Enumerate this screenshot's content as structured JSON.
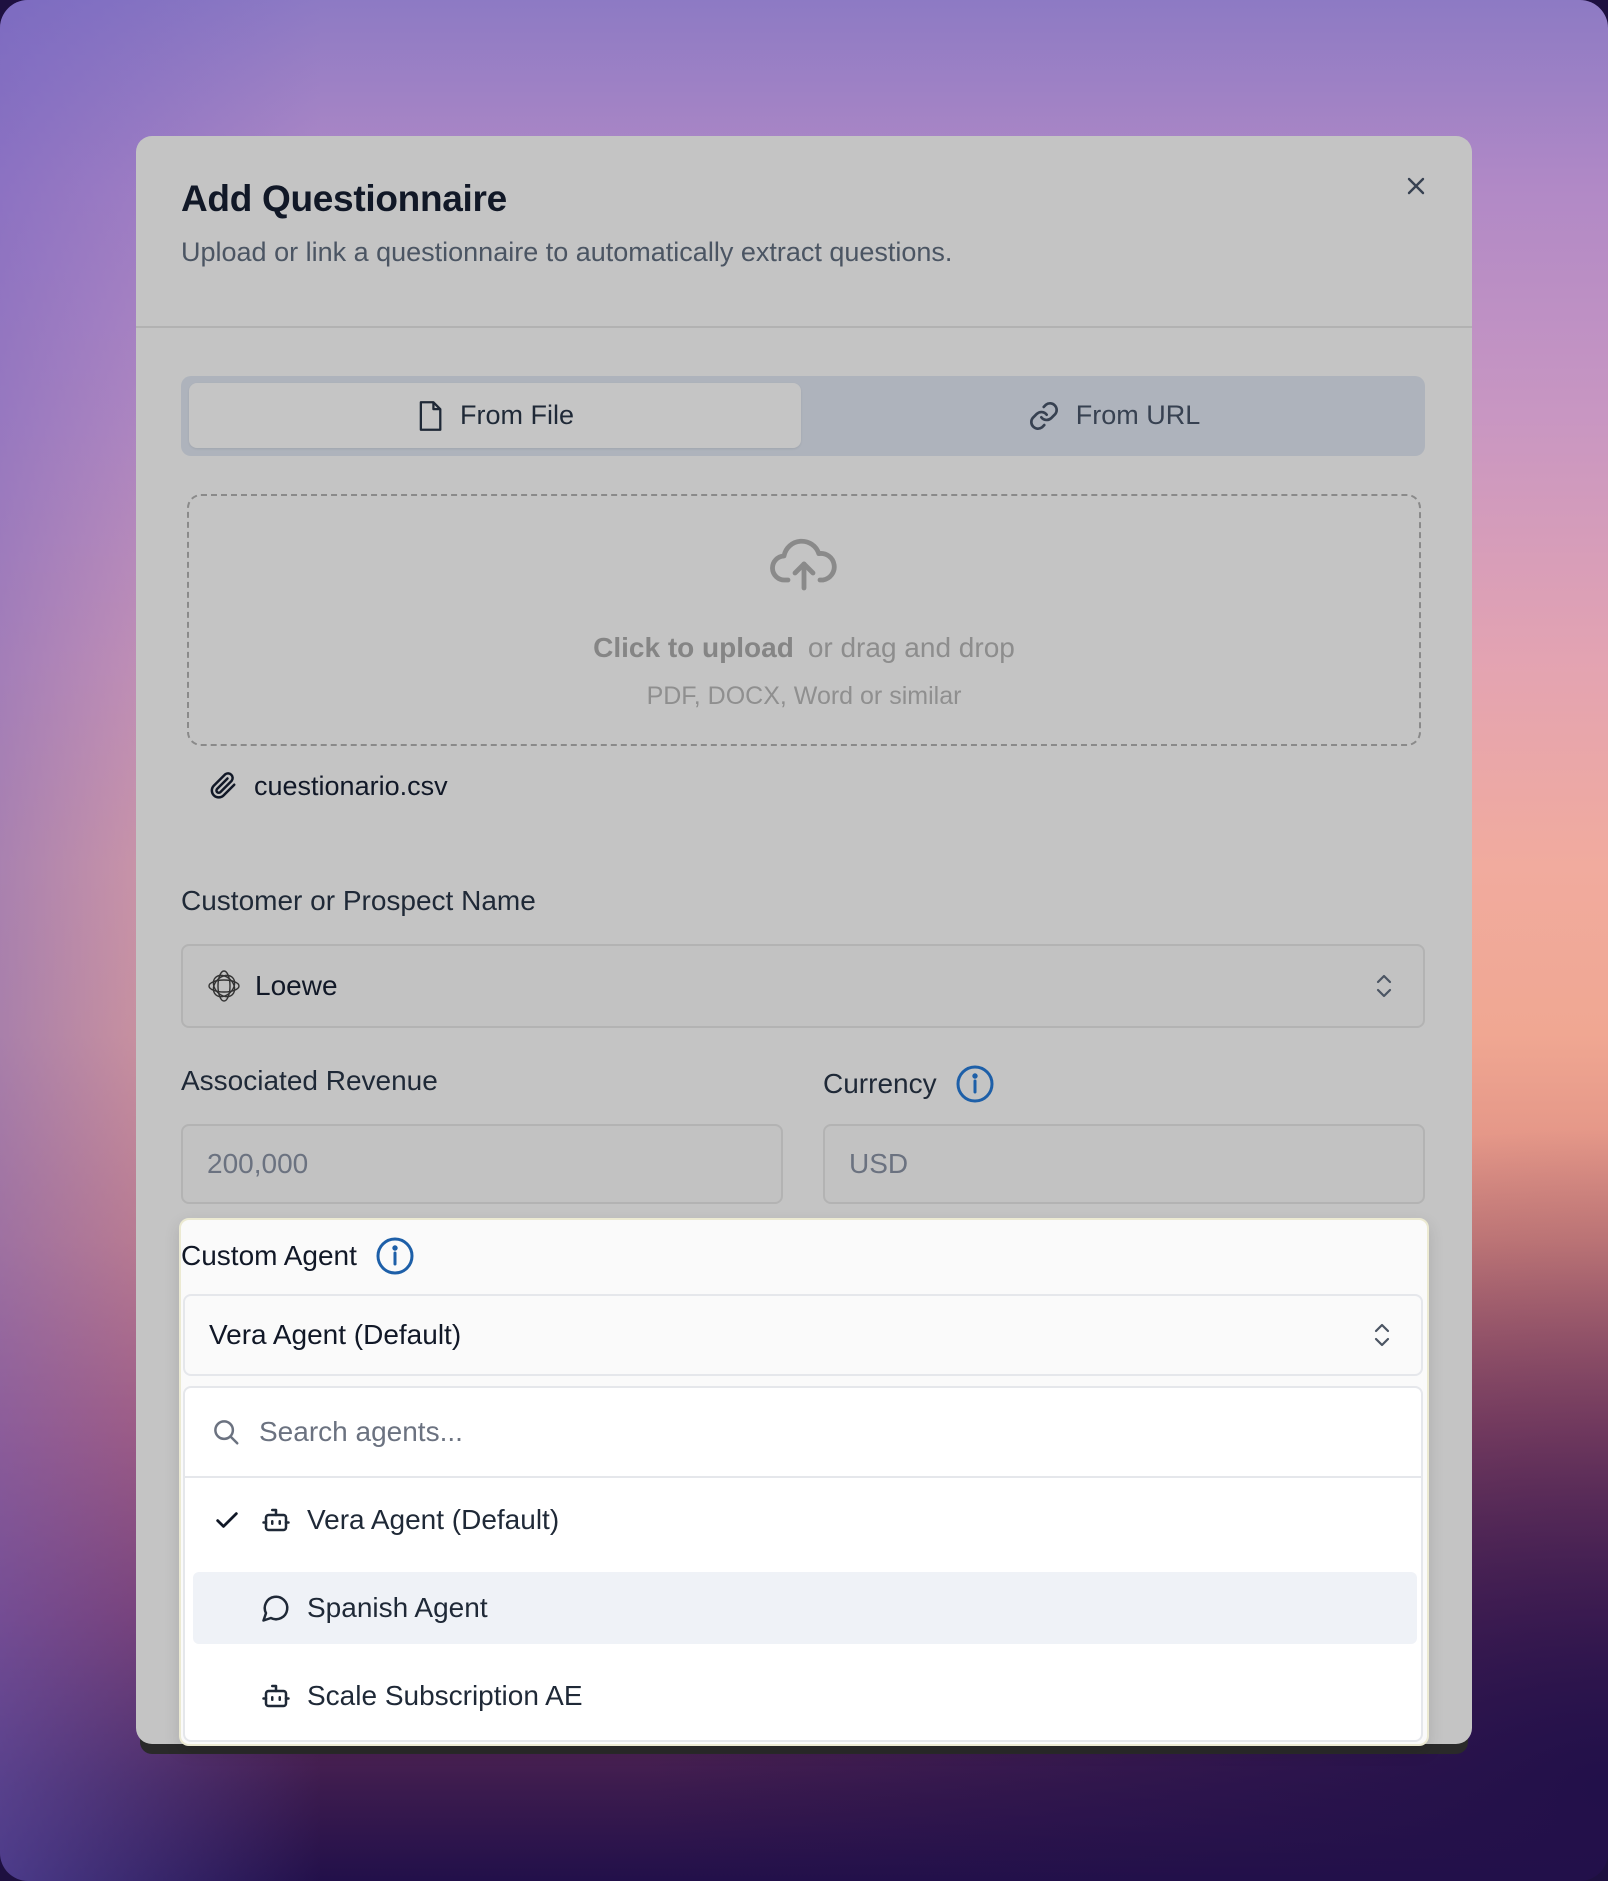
{
  "modal": {
    "title": "Add Questionnaire",
    "subtitle": "Upload or link a questionnaire to automatically extract questions."
  },
  "tabs": [
    {
      "label": "From File",
      "icon": "file-icon",
      "active": true
    },
    {
      "label": "From URL",
      "icon": "link-icon",
      "active": false
    }
  ],
  "upload": {
    "click_text": "Click to upload",
    "drag_text": "or drag and drop",
    "formats": "PDF, DOCX, Word or similar",
    "icon": "cloud-upload-icon"
  },
  "attachment": {
    "file_name": "cuestionario.csv",
    "icon": "paperclip-icon"
  },
  "customer": {
    "label": "Customer or Prospect Name",
    "value": "Loewe"
  },
  "revenue": {
    "label": "Associated Revenue",
    "placeholder": "200,000"
  },
  "currency": {
    "label": "Currency",
    "placeholder": "USD"
  },
  "agent": {
    "label": "Custom Agent",
    "selected": "Vera Agent (Default)",
    "search_placeholder": "Search agents...",
    "options": [
      {
        "label": "Vera Agent (Default)",
        "icon": "bot-icon",
        "selected": true,
        "highlighted": false
      },
      {
        "label": "Spanish Agent",
        "icon": "chat-bubble-icon",
        "selected": false,
        "highlighted": true
      },
      {
        "label": "Scale Subscription AE",
        "icon": "bot-icon",
        "selected": false,
        "highlighted": false
      }
    ]
  },
  "colors": {
    "accent_info": "#1d5fa8",
    "highlight": "#eff2f7"
  }
}
